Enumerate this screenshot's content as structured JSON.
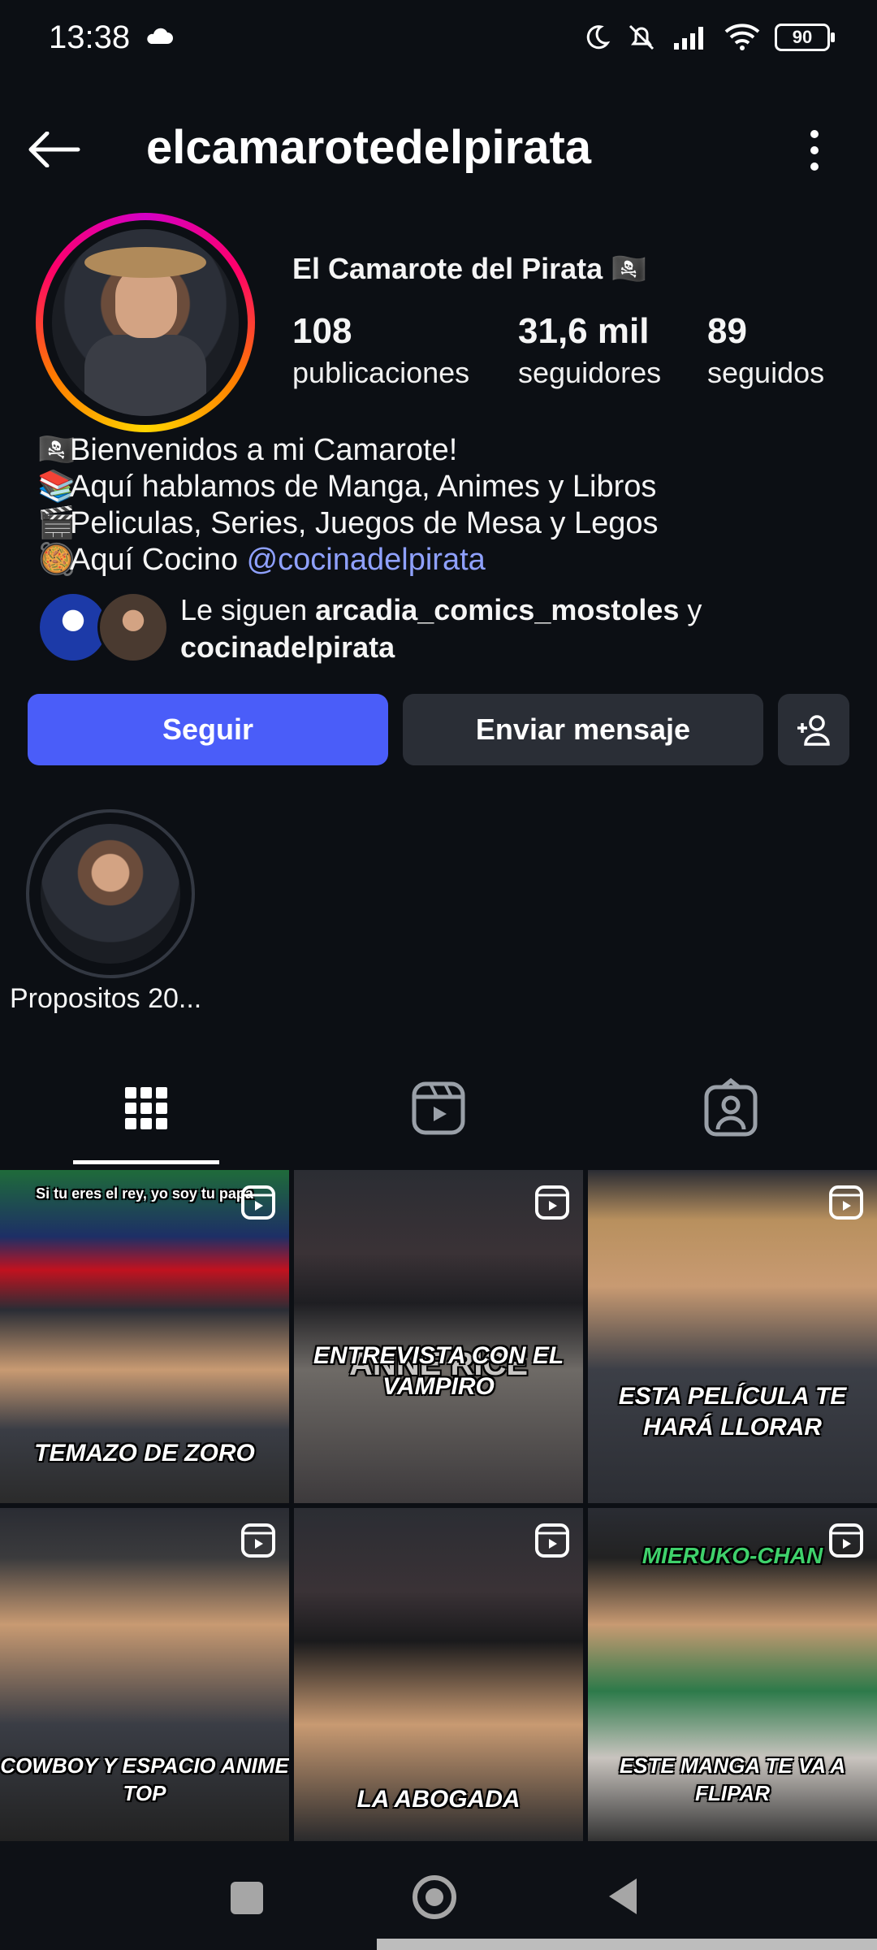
{
  "status": {
    "time": "13:38",
    "battery": "90"
  },
  "header": {
    "username": "elcamarotedelpirata"
  },
  "profile": {
    "display_name": "El Camarote del Pirata 🏴‍☠️",
    "stats": [
      {
        "value": "108",
        "label": "publicaciones"
      },
      {
        "value": "31,6 mil",
        "label": "seguidores"
      },
      {
        "value": "89",
        "label": "seguidos"
      }
    ],
    "bio": {
      "line1_emoji": "🏴‍☠️",
      "line1": "Bienvenidos a mi Camarote!",
      "line2_emoji": "📚",
      "line2": "Aquí hablamos de Manga, Animes y Libros",
      "line3_emoji": "🎬",
      "line3": "Peliculas, Series, Juegos de Mesa y Legos",
      "line4_emoji": "🥘",
      "line4_prefix": "Aquí Cocino ",
      "line4_mention": "@cocinadelpirata"
    },
    "followed_by": {
      "prefix": "Le siguen ",
      "user1": "arcadia_comics_mostoles",
      "joiner": " y",
      "user2": "cocinadelpirata"
    }
  },
  "buttons": {
    "follow": "Seguir",
    "message": "Enviar mensaje"
  },
  "highlights": [
    {
      "label": "Propositos 20..."
    }
  ],
  "grid": [
    {
      "caption": "TEMAZO DE ZORO",
      "top_text": "Si tu eres el rey, yo soy tu papa"
    },
    {
      "caption": "ENTREVISTA CON EL VAMPIRO",
      "book_title": "ANNE RICE"
    },
    {
      "caption": "ESTA PELÍCULA TE HARÁ LLORAR"
    },
    {
      "caption": "COWBOY Y ESPACIO ANIME TOP"
    },
    {
      "caption": "LA ABOGADA"
    },
    {
      "caption": "ESTE MANGA TE VA A FLIPAR",
      "book_title": "MIERUKO-CHAN"
    }
  ],
  "colors": {
    "accent": "#4a5df9",
    "mention": "#8fa1ff",
    "background": "#0c0f14"
  }
}
